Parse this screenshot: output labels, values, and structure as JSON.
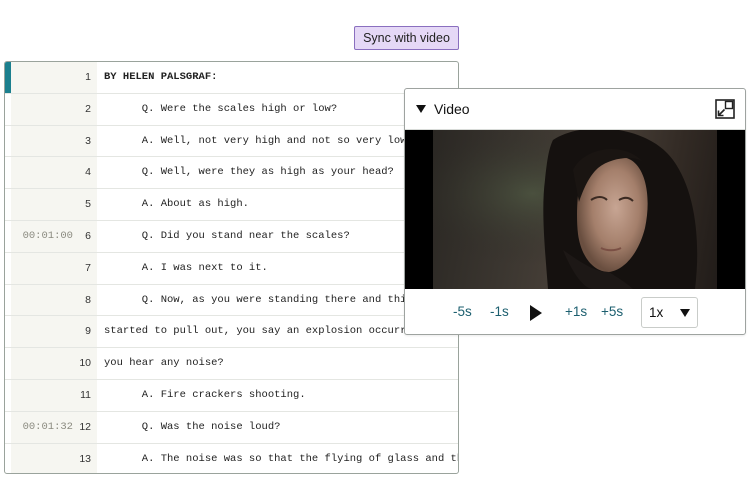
{
  "toolbar": {
    "sync_label": "Sync with video"
  },
  "transcript": {
    "rows": [
      {
        "ts": "",
        "ln": "1",
        "text": "BY HELEN PALSGRAF:"
      },
      {
        "ts": "",
        "ln": "2",
        "text": "      Q. Were the scales high or low?"
      },
      {
        "ts": "",
        "ln": "3",
        "text": "      A. Well, not very high and not so very low eit"
      },
      {
        "ts": "",
        "ln": "4",
        "text": "      Q. Well, were they as high as your head?"
      },
      {
        "ts": "",
        "ln": "5",
        "text": "      A. About as high."
      },
      {
        "ts": "00:01:00",
        "ln": "6",
        "text": "      Q. Did you stand near the scales?"
      },
      {
        "ts": "",
        "ln": "7",
        "text": "      A. I was next to it."
      },
      {
        "ts": "",
        "ln": "8",
        "text": "      Q. Now, as you were standing there and this tr"
      },
      {
        "ts": "",
        "ln": "9",
        "text": "started to pull out, you say an explosion occurred. Did"
      },
      {
        "ts": "",
        "ln": "10",
        "text": "you hear any noise?"
      },
      {
        "ts": "",
        "ln": "11",
        "text": "      A. Fire crackers shooting."
      },
      {
        "ts": "00:01:32",
        "ln": "12",
        "text": "      Q. Was the noise loud?"
      },
      {
        "ts": "",
        "ln": "13",
        "text": "      A. The noise was so that the flying of glass and the"
      }
    ]
  },
  "video": {
    "title": "Video",
    "controls": {
      "back5": "-5s",
      "back1": "-1s",
      "fwd1": "+1s",
      "fwd5": "+5s",
      "speed": "1x"
    }
  },
  "icons": {
    "collapse": "caret-down-icon",
    "popout": "popout-icon",
    "play": "play-icon",
    "speed_dropdown": "chevron-down-icon"
  },
  "colors": {
    "sync_button_bg": "#e5d8f6",
    "accent": "#1b7f8e",
    "control_text": "#1c5f6f"
  }
}
